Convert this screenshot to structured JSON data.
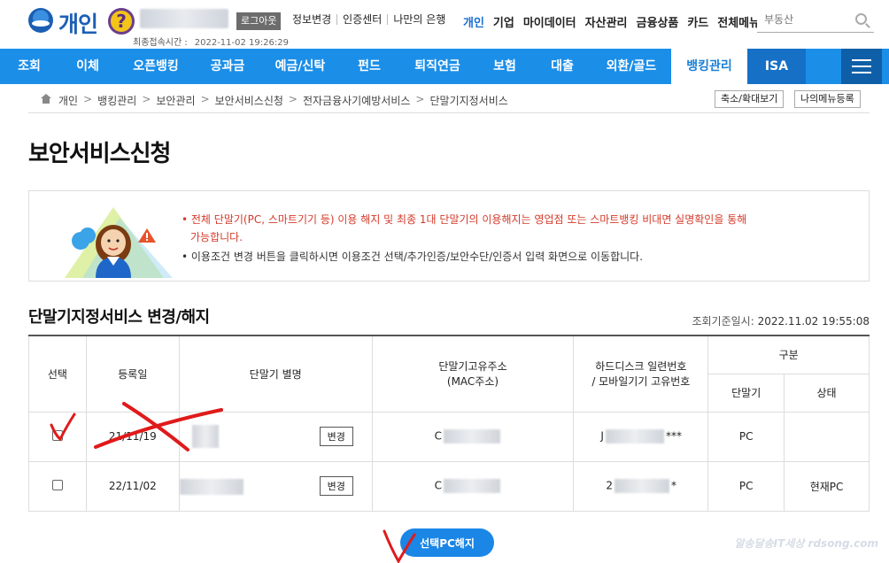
{
  "header": {
    "logo_text": "개인",
    "help_icon_glyph": "?",
    "logout_label": "로그아웃",
    "util_links": [
      "정보변경",
      "인증센터",
      "나만의 은행"
    ],
    "last_login_label": "최종접속시간 :",
    "last_login_value": "2022-11-02 19:26:29",
    "top_menu": [
      "개인",
      "기업",
      "마이데이터",
      "자산관리",
      "금융상품",
      "카드",
      "전체메뉴"
    ],
    "search_placeholder": "부동산"
  },
  "nav": {
    "items": [
      "조회",
      "이체",
      "오픈뱅킹",
      "공과금",
      "예금/신탁",
      "펀드",
      "퇴직연금",
      "보험",
      "대출",
      "외환/골드",
      "뱅킹관리",
      "ISA"
    ],
    "active_index": 10
  },
  "breadcrumb": {
    "items": [
      "개인",
      "뱅킹관리",
      "보안관리",
      "보안서비스신청",
      "전자금융사기예방서비스",
      "단말기지정서비스"
    ],
    "zoom_label": "축소/확대보기",
    "my_menu_label": "나의메뉴등록"
  },
  "page": {
    "title": "보안서비스신청"
  },
  "notice": {
    "line1": "• 전체 단말기(PC, 스마트기기 등) 이용 해지 및 최종 1대 단말기의 이용해지는 영업점 또는 스마트뱅킹 비대면 실명확인을 통해",
    "line1b": "가능합니다.",
    "line2": "• 이용조건 변경 버튼을 클릭하시면 이용조건 선택/추가인증/보안수단/인증서 입력 화면으로 이동합니다."
  },
  "section": {
    "title": "단말기지정서비스 변경/해지",
    "query_label": "조회기준일시:",
    "query_value": "2022.11.02 19:55:08"
  },
  "table": {
    "headers": {
      "select": "선택",
      "reg_date": "등록일",
      "alias": "단말기 별명",
      "mac_1": "단말기고유주소",
      "mac_2": "(MAC주소)",
      "hdd_1": "하드디스크 일련번호",
      "hdd_2": "/ 모바일기기 고유번호",
      "category": "구분",
      "device": "단말기",
      "status": "상태"
    },
    "rows": [
      {
        "date": "21/11/19",
        "edit": "변경",
        "mac_prefix": "C",
        "hdd_prefix": "J",
        "hdd_suffix": "***",
        "device": "PC",
        "status": ""
      },
      {
        "date": "22/11/02",
        "edit": "변경",
        "mac_prefix": "C",
        "hdd_prefix": "2",
        "hdd_suffix": "*",
        "device": "PC",
        "status": "현재PC"
      }
    ]
  },
  "actions": {
    "cancel_pc_label": "선택PC해지"
  },
  "watermark": "알송달송IT세상 rdsong.com",
  "colors": {
    "nav_bg": "#1b8ee8",
    "accent": "#1a86e6",
    "notice_red": "#d43a2a",
    "annotation_red": "#e01a1a"
  }
}
